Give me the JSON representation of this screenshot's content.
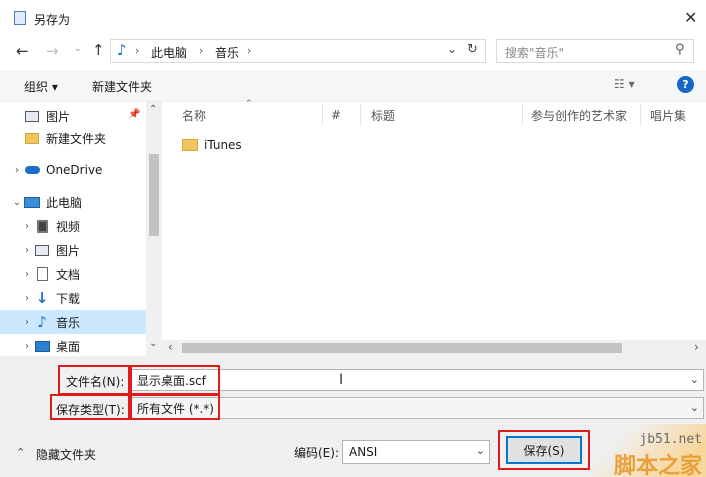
{
  "window": {
    "title": "另存为"
  },
  "nav": {
    "breadcrumb": [
      "此电脑",
      "音乐"
    ],
    "search_placeholder": "搜索\"音乐\""
  },
  "toolbar": {
    "organize": "组织 ▾",
    "new_folder": "新建文件夹"
  },
  "sidebar": {
    "items": [
      {
        "label": "图片",
        "icon": "pictures-icon",
        "pinned": true
      },
      {
        "label": "新建文件夹",
        "icon": "folder-icon"
      },
      {
        "label": "OneDrive",
        "icon": "cloud-icon"
      },
      {
        "label": "此电脑",
        "icon": "computer-icon"
      },
      {
        "label": "视频",
        "icon": "video-icon"
      },
      {
        "label": "图片",
        "icon": "pictures-icon"
      },
      {
        "label": "文档",
        "icon": "document-icon"
      },
      {
        "label": "下载",
        "icon": "download-icon"
      },
      {
        "label": "音乐",
        "icon": "music-icon",
        "selected": true
      },
      {
        "label": "桌面",
        "icon": "desktop-icon"
      }
    ]
  },
  "columns": [
    "名称",
    "#",
    "标题",
    "参与创作的艺术家",
    "唱片集"
  ],
  "files": [
    {
      "name": "iTunes",
      "icon": "folder-icon"
    }
  ],
  "form": {
    "filename_label": "文件名(N):",
    "filename_value": "显示桌面.scf",
    "filetype_label": "保存类型(T):",
    "filetype_value": "所有文件  (*.*)",
    "encoding_label": "编码(E):",
    "encoding_value": "ANSI"
  },
  "footer": {
    "hide_folders": "隐藏文件夹",
    "save_button": "保存(S)"
  },
  "watermark": {
    "site": "jb51.net",
    "name": "脚本之家"
  },
  "colors": {
    "accent": "#0078d7",
    "highlight_border": "#e01b1b",
    "selected_bg": "#cce8ff",
    "watermark": "#e8a13a"
  }
}
